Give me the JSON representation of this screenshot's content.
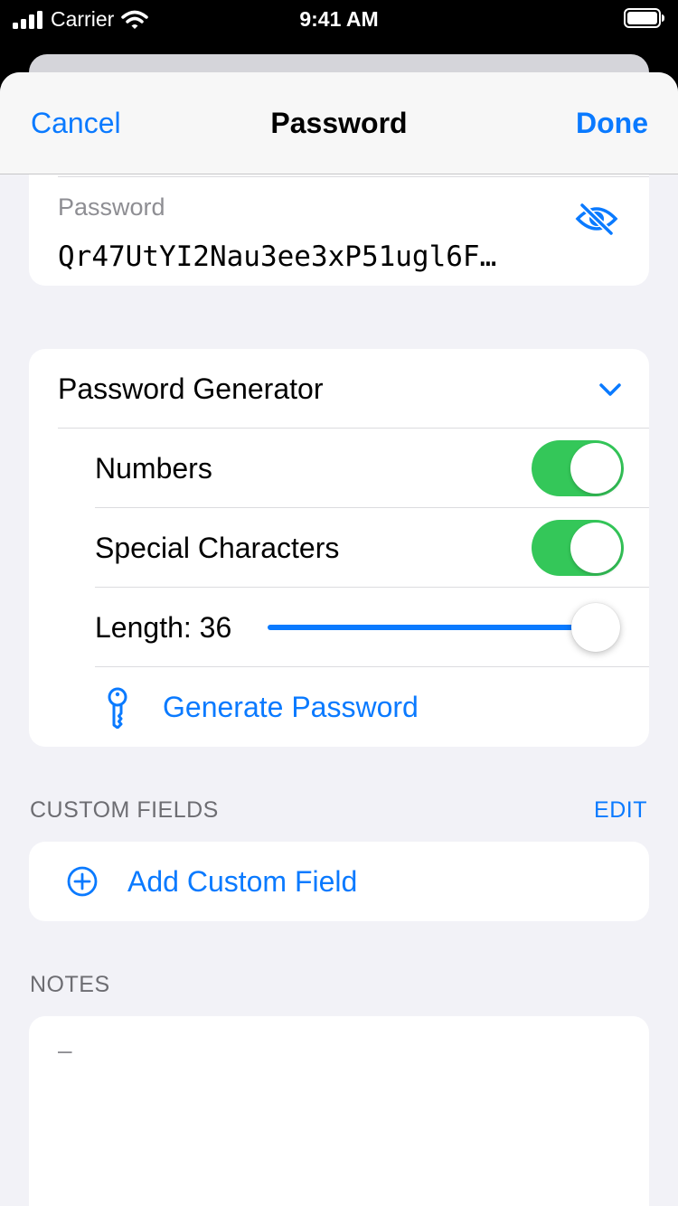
{
  "status_bar": {
    "carrier": "Carrier",
    "time": "9:41 AM",
    "icons": [
      "signal-icon",
      "wifi-icon",
      "battery-icon"
    ]
  },
  "navbar": {
    "cancel_label": "Cancel",
    "title": "Password",
    "done_label": "Done"
  },
  "password_field": {
    "label": "Password",
    "value": "Qr47UtYI2Nau3ee3xP51ugl6F…",
    "visibility_icon": "eye-slash-icon"
  },
  "generator": {
    "title": "Password Generator",
    "expand_icon": "chevron-down-icon",
    "options": [
      {
        "label": "Numbers",
        "enabled": true
      },
      {
        "label": "Special Characters",
        "enabled": true
      }
    ],
    "length": {
      "label": "Length: 36",
      "value": 36,
      "fill_fraction": 1.0
    },
    "generate_label": "Generate Password",
    "generate_icon": "key-icon"
  },
  "custom_fields": {
    "header": "CUSTOM FIELDS",
    "edit_label": "EDIT",
    "add_label": "Add Custom Field",
    "add_icon": "plus-circle-icon"
  },
  "notes": {
    "header": "NOTES",
    "placeholder": "–"
  },
  "colors": {
    "accent": "#0a7aff",
    "toggle_on": "#34c759",
    "background": "#f2f2f7",
    "secondary_text": "#8e8e93"
  }
}
